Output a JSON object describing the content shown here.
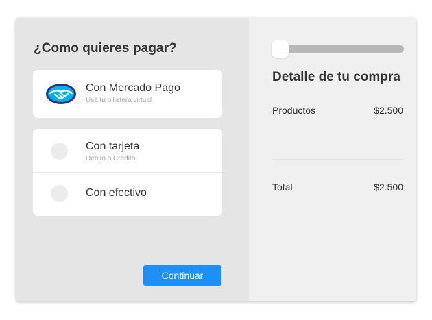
{
  "payment": {
    "title": "¿Como quieres pagar?",
    "options": [
      {
        "label": "Con Mercado Pago",
        "sublabel": "Usá tu billetera virtual"
      },
      {
        "label": "Con tarjeta",
        "sublabel": "Débito o Crédito"
      },
      {
        "label": "Con efectivo",
        "sublabel": ""
      }
    ],
    "continue_label": "Continuar"
  },
  "summary": {
    "title": "Detalle de tu compra",
    "products_label": "Productos",
    "products_value": "$2.500",
    "total_label": "Total",
    "total_value": "$2.500",
    "slider_value": 0
  },
  "icons": {
    "mercado_pago": "mercado-pago-handshake-icon"
  },
  "colors": {
    "accent": "#1d8ff5",
    "logo_blue": "#2d3277",
    "logo_light_blue": "#00b1ea"
  }
}
